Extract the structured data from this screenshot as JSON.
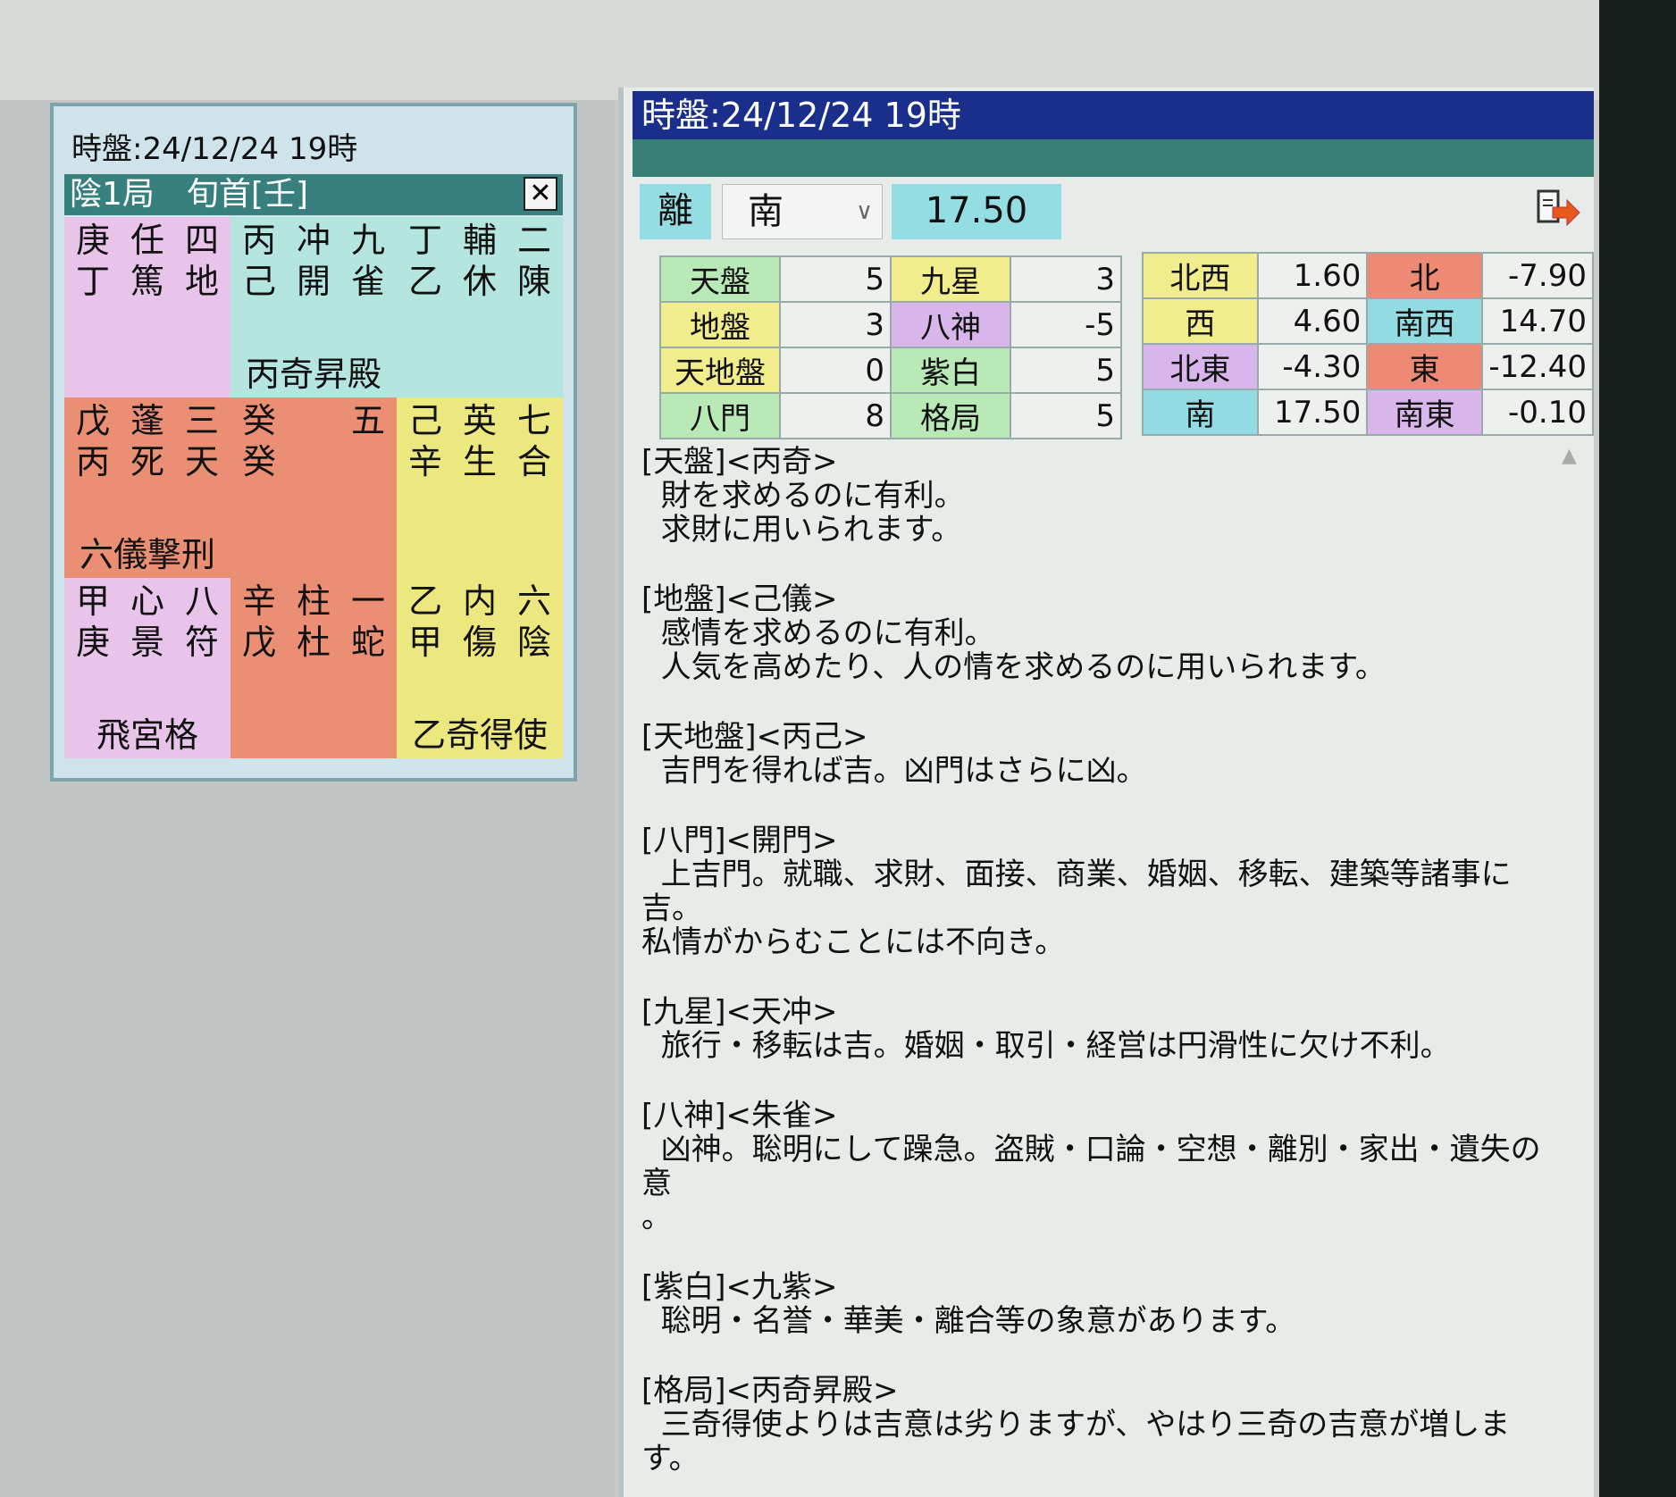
{
  "small_window": {
    "title": "時盤:24/12/24 19時",
    "bar_title": "陰1局　旬首[壬]",
    "close_label": "✕",
    "cells": [
      {
        "color": "#e8c4ea",
        "r1": [
          "庚",
          "任",
          "四"
        ],
        "r2": [
          "丁",
          "篤",
          "地"
        ],
        "foot": ""
      },
      {
        "color": "#b4e5df",
        "r1": [
          "丙",
          "冲",
          "九"
        ],
        "r2": [
          "己",
          "開",
          "雀"
        ],
        "foot": "丙奇昇殿"
      },
      {
        "color": "#b4e5df",
        "r1": [
          "丁",
          "輔",
          "二"
        ],
        "r2": [
          "乙",
          "休",
          "陳"
        ],
        "foot": ""
      },
      {
        "color": "#ea8f74",
        "r1": [
          "戊",
          "蓬",
          "三"
        ],
        "r2": [
          "丙",
          "死",
          "天"
        ],
        "foot": "六儀撃刑"
      },
      {
        "color": "#ea8f74",
        "r1": [
          "癸",
          "",
          "五"
        ],
        "r2": [
          "癸",
          "",
          ""
        ],
        "foot": ""
      },
      {
        "color": "#ece77f",
        "r1": [
          "己",
          "英",
          "七"
        ],
        "r2": [
          "辛",
          "生",
          "合"
        ],
        "foot": ""
      },
      {
        "color": "#e8c4ea",
        "r1": [
          "甲",
          "心",
          "八"
        ],
        "r2": [
          "庚",
          "景",
          "符"
        ],
        "foot": "飛宮格"
      },
      {
        "color": "#ea8f74",
        "r1": [
          "辛",
          "柱",
          "一"
        ],
        "r2": [
          "戊",
          "杜",
          "蛇"
        ],
        "foot": ""
      },
      {
        "color": "#ece77f",
        "r1": [
          "乙",
          "内",
          "六"
        ],
        "r2": [
          "甲",
          "傷",
          "陰"
        ],
        "foot": "乙奇得使"
      }
    ]
  },
  "main_window": {
    "title": "時盤:24/12/24 19時",
    "palace": "離",
    "direction": "南",
    "value": "17.50",
    "exit_icon": "exit-icon",
    "left_table": [
      {
        "l1": "天盤",
        "v1": "5",
        "l2": "九星",
        "v2": "3"
      },
      {
        "l1": "地盤",
        "v1": "3",
        "l2": "八神",
        "v2": "-5"
      },
      {
        "l1": "天地盤",
        "v1": "0",
        "l2": "紫白",
        "v2": "5"
      },
      {
        "l1": "八門",
        "v1": "8",
        "l2": "格局",
        "v2": "5"
      }
    ],
    "right_table": [
      {
        "l1": "北西",
        "v1": "1.60",
        "l2": "北",
        "v2": "-7.90"
      },
      {
        "l1": "西",
        "v1": "4.60",
        "l2": "南西",
        "v2": "14.70"
      },
      {
        "l1": "北東",
        "v1": "-4.30",
        "l2": "東",
        "v2": "-12.40"
      },
      {
        "l1": "南",
        "v1": "17.50",
        "l2": "南東",
        "v2": "-0.10"
      }
    ],
    "descriptions": [
      "[天盤]<丙奇>\n  財を求めるのに有利。\n  求財に用いられます。",
      "[地盤]<己儀>\n  感情を求めるのに有利。\n  人気を高めたり、人の情を求めるのに用いられます。",
      "[天地盤]<丙己>\n  吉門を得れば吉。凶門はさらに凶。",
      "[八門]<開門>\n  上吉門。就職、求財、面接、商業、婚姻、移転、建築等諸事に\n吉。\n私情がからむことには不向き。",
      "[九星]<天冲>\n  旅行・移転は吉。婚姻・取引・経営は円滑性に欠け不利。",
      "[八神]<朱雀>\n  凶神。聡明にして躁急。盗賊・口論・空想・離別・家出・遺失の意\n。",
      "[紫白]<九紫>\n  聡明・名誉・華美・離合等の象意があります。",
      "[格局]<丙奇昇殿>\n  三奇得使よりは吉意は劣りますが、やはり三奇の吉意が増しま\nす。"
    ]
  }
}
